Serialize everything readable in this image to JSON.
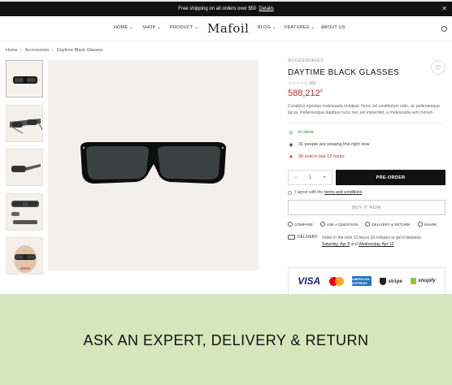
{
  "announcement": {
    "text": "Free shipping on all orders over $50",
    "link": "Details"
  },
  "nav": {
    "left_items": [
      "HOME",
      "SHOP",
      "PRODUCT"
    ],
    "logo": "Mafoil",
    "right_items": [
      "BLOG",
      "FEATURED",
      "ABOUT US"
    ]
  },
  "breadcrumb": [
    "Home",
    "Accessories",
    "Daytime Black Glasses"
  ],
  "product": {
    "category": "ACCESSORIES",
    "title": "DAYTIME BLACK GLASSES",
    "rating_count": "(0)",
    "price": "588,212",
    "currency": "đ",
    "description": "Curabitur egestas malesuada volutpat. Nunc vel vestibulum odio, ac pellentesque lacus. Pellentesque dapibus nunc nec est imperdiet, a malesuada sem rutrum",
    "stock": "In stock",
    "viewers": "31 people are viewing this right now",
    "sold": "36 sold in last 12 hours",
    "quantity": "1",
    "preorder_label": "PRE-ORDER",
    "agree_text": "I agree with the",
    "agree_link": "terms and conditions",
    "buy_now_label": "BUY IT NOW",
    "links": [
      "COMPARE",
      "ASK A QUESTION",
      "DELIVERY & RETURN",
      "SHARE"
    ],
    "delivery_label": "DELIVERY:",
    "delivery_text": "Order in the next 13 hours 33 minutes to get it between",
    "delivery_date_1": "Saturday, Apr 8",
    "delivery_and": "and",
    "delivery_date_2": "Wednesday, Apr 12"
  },
  "payments": {
    "visa": "VISA",
    "amex": "AMERICAN EXPRESS",
    "stripe": "stripe",
    "shopify": "shopify"
  },
  "banner": {
    "text": "ASK AN EXPERT, DELIVERY & RETURN"
  },
  "colors": {
    "price": "#b52b25",
    "in_stock": "#2b8a3e",
    "sold": "#c62828",
    "banner_bg": "#d6e6bd"
  }
}
